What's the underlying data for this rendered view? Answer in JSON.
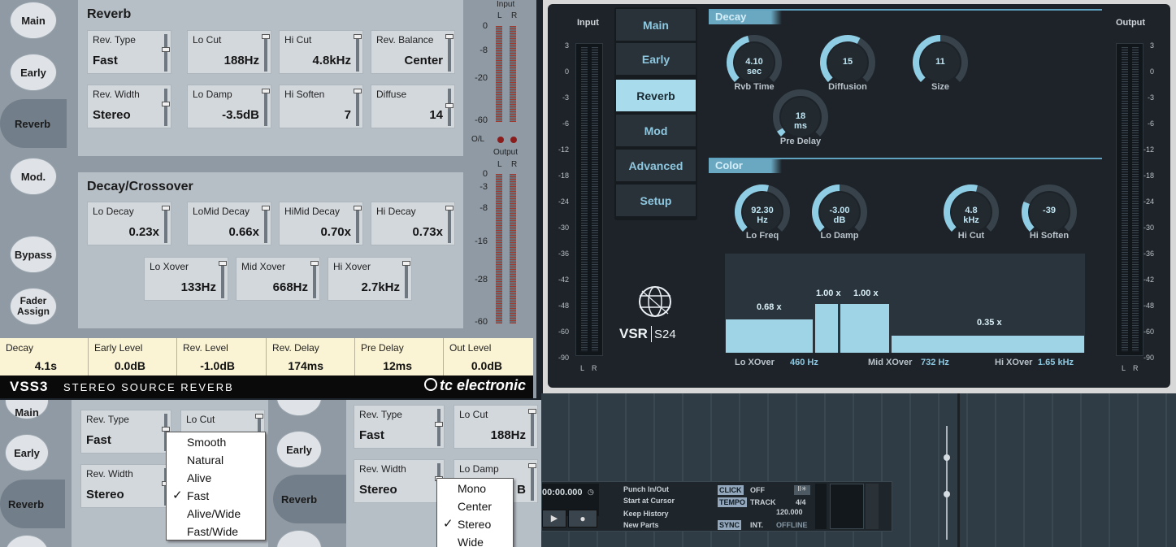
{
  "vss3": {
    "nav": [
      "Main",
      "Early",
      "Reverb",
      "Mod.",
      "Bypass",
      "Fader Assign"
    ],
    "reverb": {
      "title": "Reverb",
      "params": [
        {
          "label": "Rev. Type",
          "value": "Fast"
        },
        {
          "label": "Lo Cut",
          "value": "188Hz"
        },
        {
          "label": "Hi Cut",
          "value": "4.8kHz"
        },
        {
          "label": "Rev. Balance",
          "value": "Center"
        },
        {
          "label": "Rev. Width",
          "value": "Stereo"
        },
        {
          "label": "Lo Damp",
          "value": "-3.5dB"
        },
        {
          "label": "Hi Soften",
          "value": "7"
        },
        {
          "label": "Diffuse",
          "value": "14"
        }
      ]
    },
    "decay": {
      "title": "Decay/Crossover",
      "params": [
        {
          "label": "Lo Decay",
          "value": "0.23x"
        },
        {
          "label": "LoMid Decay",
          "value": "0.66x"
        },
        {
          "label": "HiMid Decay",
          "value": "0.70x"
        },
        {
          "label": "Hi Decay",
          "value": "0.73x"
        },
        {
          "label": "Lo Xover",
          "value": "133Hz"
        },
        {
          "label": "Mid Xover",
          "value": "668Hz"
        },
        {
          "label": "Hi Xover",
          "value": "2.7kHz"
        }
      ]
    },
    "meters": {
      "input_label": "Input",
      "output_label": "Output",
      "l": "L",
      "r": "R",
      "ol": "O/L",
      "input_scale": [
        "0",
        "-8",
        "-20",
        "-60"
      ],
      "output_scale": [
        "0",
        "-3",
        "-8",
        "-16",
        "-28",
        "-60"
      ]
    },
    "bottom": [
      {
        "label": "Decay",
        "value": "4.1s"
      },
      {
        "label": "Early Level",
        "value": "0.0dB"
      },
      {
        "label": "Rev. Level",
        "value": "-1.0dB"
      },
      {
        "label": "Rev. Delay",
        "value": "174ms"
      },
      {
        "label": "Pre Delay",
        "value": "12ms"
      },
      {
        "label": "Out Level",
        "value": "0.0dB"
      }
    ],
    "footer_name": "VSS3",
    "footer_sub": "STEREO SOURCE REVERB",
    "footer_brand": "tc electronic"
  },
  "vsr": {
    "input_label": "Input",
    "output_label": "Output",
    "meter_scale": [
      "3",
      "0",
      "-3",
      "-6",
      "-12",
      "-18",
      "-24",
      "-30",
      "-36",
      "-42",
      "-48",
      "-60",
      "-90"
    ],
    "l": "L",
    "r": "R",
    "tabs": [
      "Main",
      "Early",
      "Reverb",
      "Mod",
      "Advanced",
      "Setup"
    ],
    "logo": "VSR",
    "logo_sub": "S24",
    "decay_title": "Decay",
    "decay_knobs": [
      {
        "label": "Rvb Time",
        "value": "4.10",
        "unit": "sec",
        "level": 0.45
      },
      {
        "label": "Diffusion",
        "value": "15",
        "unit": "",
        "level": 0.6
      },
      {
        "label": "Size",
        "value": "11",
        "unit": "",
        "level": 0.5
      },
      {
        "label": "Pre Delay",
        "value": "18",
        "unit": "ms",
        "level": 0.05
      }
    ],
    "color_title": "Color",
    "color_knobs": [
      {
        "label": "Lo Freq",
        "value": "92.30",
        "unit": "Hz",
        "level": 0.55
      },
      {
        "label": "Lo Damp",
        "value": "-3.00",
        "unit": "dB",
        "level": 0.5
      },
      {
        "label": "Hi Cut",
        "value": "4.8",
        "unit": "kHz",
        "level": 0.55
      },
      {
        "label": "Hi Soften",
        "value": "-39",
        "unit": "",
        "level": 0.25
      }
    ],
    "bars": [
      {
        "label": "0.68 x",
        "level": 0.68
      },
      {
        "label": "1.00 x",
        "level": 1.0
      },
      {
        "label": "1.00 x",
        "level": 1.0
      },
      {
        "label": "0.35 x",
        "level": 0.35
      }
    ],
    "xover": [
      {
        "label": "Lo XOver",
        "value": "460 Hz"
      },
      {
        "label": "Mid XOver",
        "value": "732 Hz"
      },
      {
        "label": "Hi XOver",
        "value": "1.65 kHz"
      }
    ]
  },
  "bottom_left": {
    "nav": [
      "Main",
      "Early",
      "Reverb"
    ],
    "params": [
      {
        "label": "Rev. Type",
        "value": "Fast"
      },
      {
        "label": "Lo Cut",
        "value": ""
      },
      {
        "label": "Rev. Width",
        "value": "Stereo"
      }
    ],
    "menu": [
      "Smooth",
      "Natural",
      "Alive",
      "Fast",
      "Alive/Wide",
      "Fast/Wide"
    ],
    "menu_checked": "Fast"
  },
  "bottom_mid": {
    "nav": [
      "Early",
      "Reverb"
    ],
    "params": [
      {
        "label": "Rev. Type",
        "value": "Fast"
      },
      {
        "label": "Lo Cut",
        "value": "188Hz"
      },
      {
        "label": "Rev. Width",
        "value": "Stereo"
      },
      {
        "label": "Lo Damp",
        "value": "B"
      }
    ],
    "menu": [
      "Mono",
      "Center",
      "Stereo",
      "Wide"
    ],
    "menu_checked": "Stereo"
  },
  "transport": {
    "time": "00:00.000",
    "punch": "Punch In/Out",
    "start": "Start at Cursor",
    "keep": "Keep History",
    "new_parts": "New Parts",
    "click": "CLICK",
    "click_val": "OFF",
    "tempo": "TEMPO",
    "tempo_mode": "TRACK",
    "sig": "4/4",
    "bpm": "120.000",
    "sync": "SYNC",
    "sync_val": "INT.",
    "offline": "OFFLINE"
  }
}
